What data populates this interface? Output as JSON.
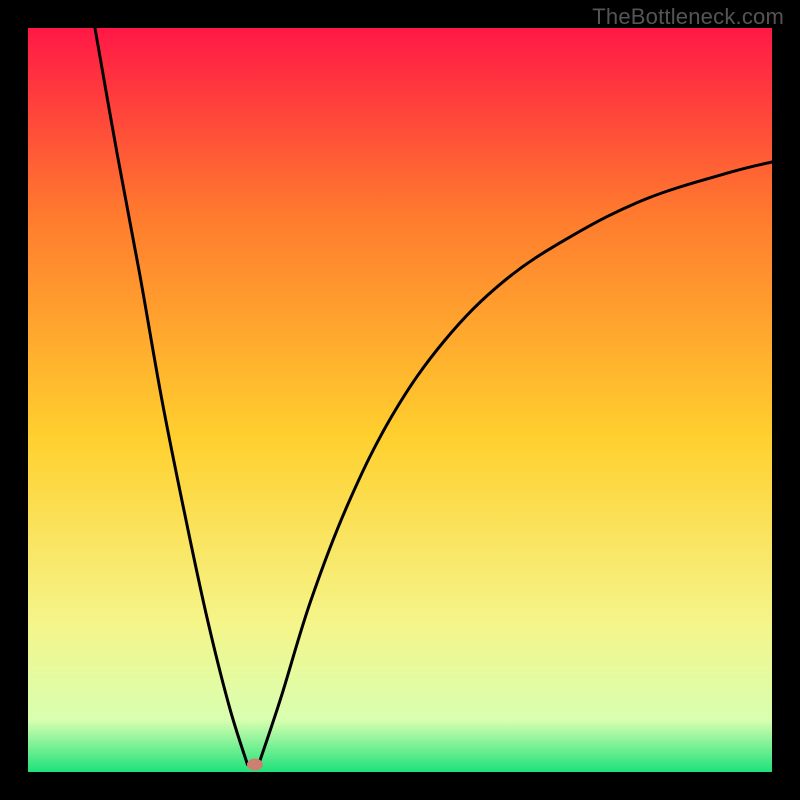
{
  "watermark": "TheBottleneck.com",
  "chart_data": {
    "type": "line",
    "title": "",
    "xlabel": "",
    "ylabel": "",
    "xlim": [
      0,
      100
    ],
    "ylim": [
      0,
      100
    ],
    "grid": false,
    "colors": {
      "gradient_top": "#ff1846",
      "gradient_mid_upper": "#ff7a2e",
      "gradient_mid": "#ffd02e",
      "gradient_lower": "#f5f58a",
      "gradient_band": "#d8ffb0",
      "gradient_bottom": "#1de27a",
      "curve": "#000000",
      "marker": "#cc8070",
      "frame": "#000000"
    },
    "marker": {
      "x": 30.5,
      "y": 1.0
    },
    "series": [
      {
        "name": "left-branch",
        "x": [
          9,
          12,
          15,
          18,
          21,
          24,
          27,
          29.5
        ],
        "values": [
          100,
          83,
          67,
          50,
          35,
          21,
          9,
          1
        ]
      },
      {
        "name": "right-branch",
        "x": [
          31,
          34,
          38,
          43,
          49,
          56,
          64,
          73,
          83,
          94,
          100
        ],
        "values": [
          1,
          10,
          23,
          36,
          48,
          58,
          66,
          72,
          77,
          80.5,
          82
        ]
      }
    ],
    "annotations": []
  }
}
